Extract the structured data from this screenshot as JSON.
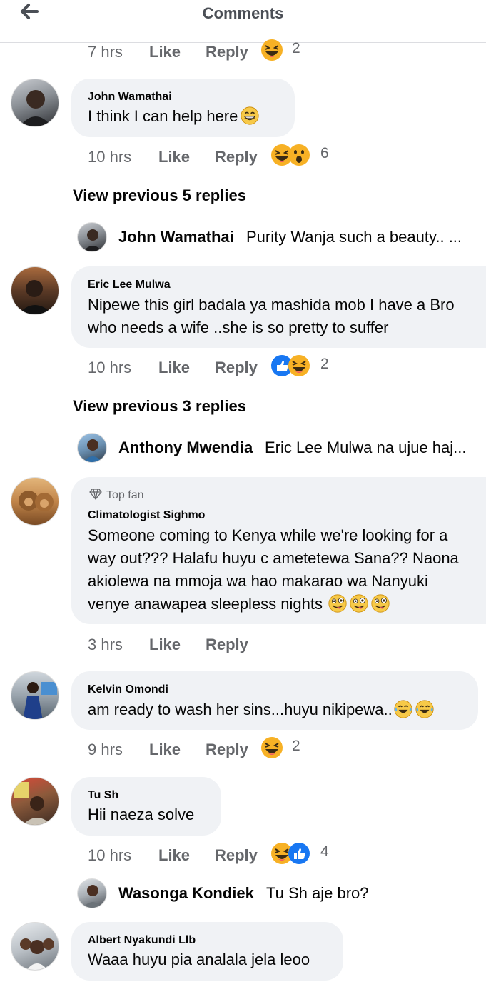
{
  "header": {
    "title": "Comments",
    "back_icon": "arrow-left-icon"
  },
  "labels": {
    "like": "Like",
    "reply": "Reply"
  },
  "top_actions": {
    "time": "7 hrs",
    "reaction_count": "2",
    "reactions": [
      "laugh"
    ]
  },
  "comments": [
    {
      "author": "John Wamathai",
      "text": "I think I can help here",
      "emojis": [
        "grin"
      ],
      "time": "10 hrs",
      "reactions": [
        "laugh",
        "wow"
      ],
      "reaction_count": "6",
      "view_previous": "View previous 5 replies",
      "latest_reply": {
        "author": "John Wamathai",
        "text": "Purity Wanja such a beauty.. ..."
      }
    },
    {
      "author": "Eric Lee Mulwa",
      "text_lines": [
        "Nipewe this girl badala ya mashida mob I have a Bro",
        "who needs a wife ..she is so pretty to suffer"
      ],
      "time": "10 hrs",
      "reactions": [
        "like",
        "laugh"
      ],
      "reaction_count": "2",
      "view_previous": "View previous 3 replies",
      "latest_reply": {
        "author": "Anthony Mwendia",
        "text": "Eric Lee Mulwa na ujue haj..."
      }
    },
    {
      "badge": "Top fan",
      "badge_icon": "diamond-icon",
      "author": "Climatologist Sighmo",
      "text_lines": [
        "Someone coming to Kenya while we're looking for a",
        "way out??? Halafu huyu c ametetewa Sana?? Naona",
        "akiolewa na mmoja wa hao makarao wa Nanyuki",
        "venye anawapea sleepless nights"
      ],
      "emojis": [
        "winky-tongue",
        "winky-tongue",
        "winky-tongue"
      ],
      "time": "3 hrs"
    },
    {
      "author": "Kelvin Omondi",
      "text": "am ready to wash her sins...huyu nikipewa..",
      "emojis": [
        "tears-of-joy",
        "tears-of-joy"
      ],
      "time": "9 hrs",
      "reactions": [
        "laugh"
      ],
      "reaction_count": "2"
    },
    {
      "author": "Tu Sh",
      "text": "Hii naeza solve",
      "time": "10 hrs",
      "reactions": [
        "laugh",
        "like"
      ],
      "reaction_count": "4",
      "latest_reply": {
        "author": "Wasonga Kondiek",
        "text": "Tu Sh aje bro?"
      }
    },
    {
      "author": "Albert Nyakundi Llb",
      "text": "Waaa huyu pia analala jela leoo"
    }
  ],
  "colors": {
    "like_blue": "#1877f2",
    "emoji_yellow": "#f7b125",
    "bubble": "#f0f2f5",
    "muted": "#65676b"
  }
}
